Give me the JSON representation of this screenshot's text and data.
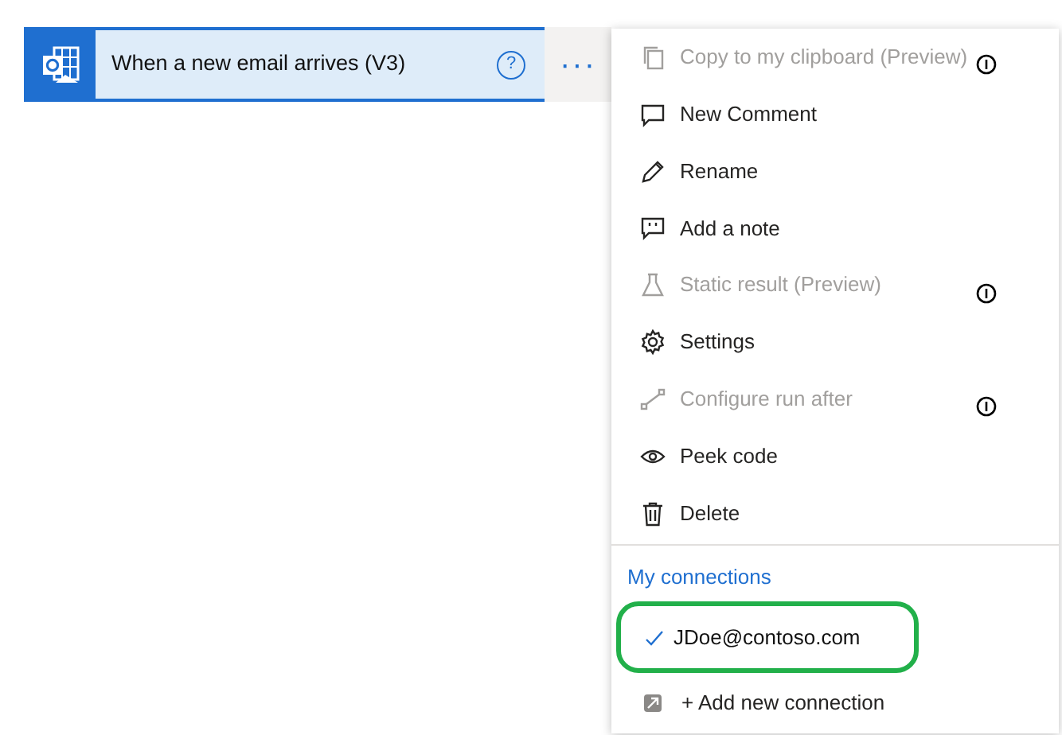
{
  "trigger_card": {
    "title": "When a new email arrives (V3)",
    "help": "?",
    "more": "···"
  },
  "menu": {
    "items": [
      {
        "label": "Copy to my clipboard (Preview)",
        "disabled": true,
        "info": true
      },
      {
        "label": "New Comment",
        "disabled": false,
        "info": false
      },
      {
        "label": "Rename",
        "disabled": false,
        "info": false
      },
      {
        "label": "Add a note",
        "disabled": false,
        "info": false
      },
      {
        "label": "Static result (Preview)",
        "disabled": true,
        "info": true
      },
      {
        "label": "Settings",
        "disabled": false,
        "info": false
      },
      {
        "label": "Configure run after",
        "disabled": true,
        "info": true
      },
      {
        "label": "Peek code",
        "disabled": false,
        "info": false
      },
      {
        "label": "Delete",
        "disabled": false,
        "info": false
      }
    ],
    "connections_header": "My connections",
    "connections": [
      {
        "label": "JDoe@contoso.com",
        "selected": true,
        "highlighted": true
      }
    ],
    "add_connection": "+ Add new connection"
  }
}
